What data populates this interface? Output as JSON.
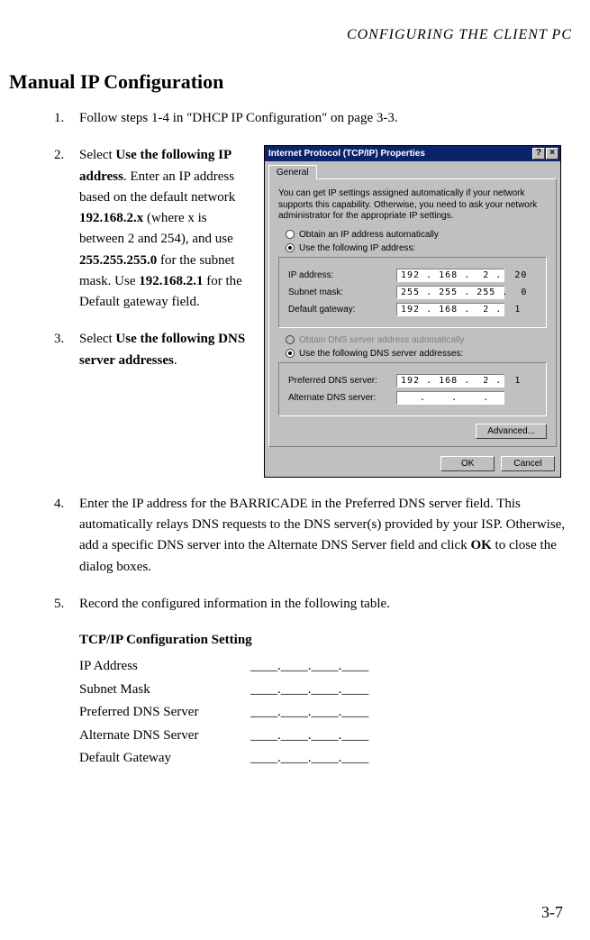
{
  "header": "CONFIGURING THE CLIENT PC",
  "title": "Manual IP Configuration",
  "steps": {
    "s1": {
      "num": "1.",
      "text": "Follow steps 1-4 in \"DHCP IP Configuration\" on page 3-3."
    },
    "s2": {
      "num": "2.",
      "p1": "Select ",
      "b1": "Use the following IP address",
      "p2": ". Enter an IP address based on the default network ",
      "b2": "192.168.2.x",
      "p3": " (where x is between 2 and 254), and use ",
      "b3": "255.255.255.0",
      "p4": " for the subnet mask. Use ",
      "b4": "192.168.2.1",
      "p5": " for the Default gateway field."
    },
    "s3": {
      "num": "3.",
      "p1": "Select ",
      "b1": "Use the following DNS server addresses",
      "p2": "."
    },
    "s4": {
      "num": "4.",
      "p1": "Enter the IP address for the BARRICADE in the Preferred DNS server field. This automatically relays DNS requests to the DNS server(s) provided by your ISP. Otherwise, add a specific DNS server into the Alternate DNS Server field and click ",
      "b1": "OK",
      "p2": " to close the dialog boxes."
    },
    "s5": {
      "num": "5.",
      "text": "Record the configured information in the following table."
    }
  },
  "dialog": {
    "title": "Internet Protocol (TCP/IP) Properties",
    "help": "?",
    "close": "×",
    "tab": "General",
    "intro": "You can get IP settings assigned automatically if your network supports this capability. Otherwise, you need to ask your network administrator for the appropriate IP settings.",
    "r1": "Obtain an IP address automatically",
    "r2": "Use the following IP address:",
    "ip_label": "IP address:",
    "ip_val": "192 . 168 .  2 .  20",
    "mask_label": "Subnet mask:",
    "mask_val": "255 . 255 . 255 .  0",
    "gw_label": "Default gateway:",
    "gw_val": "192 . 168 .  2 .  1",
    "r3": "Obtain DNS server address automatically",
    "r4": "Use the following DNS server addresses:",
    "pdns_label": "Preferred DNS server:",
    "pdns_val": "192 . 168 .  2 .  1",
    "adns_label": "Alternate DNS server:",
    "adns_val": "   .    .    .   ",
    "advanced": "Advanced...",
    "ok": "OK",
    "cancel": "Cancel"
  },
  "table": {
    "title": "TCP/IP Configuration Setting",
    "rows": {
      "ip": {
        "label": "IP Address",
        "value": "____.____.____.____"
      },
      "mask": {
        "label": "Subnet Mask",
        "value": "____.____.____.____"
      },
      "pdns": {
        "label": "Preferred DNS Server",
        "value": "____.____.____.____"
      },
      "adns": {
        "label": "Alternate DNS Server",
        "value": "____.____.____.____"
      },
      "gw": {
        "label": "Default Gateway",
        "value": "____.____.____.____"
      }
    }
  },
  "page_num": "3-7"
}
